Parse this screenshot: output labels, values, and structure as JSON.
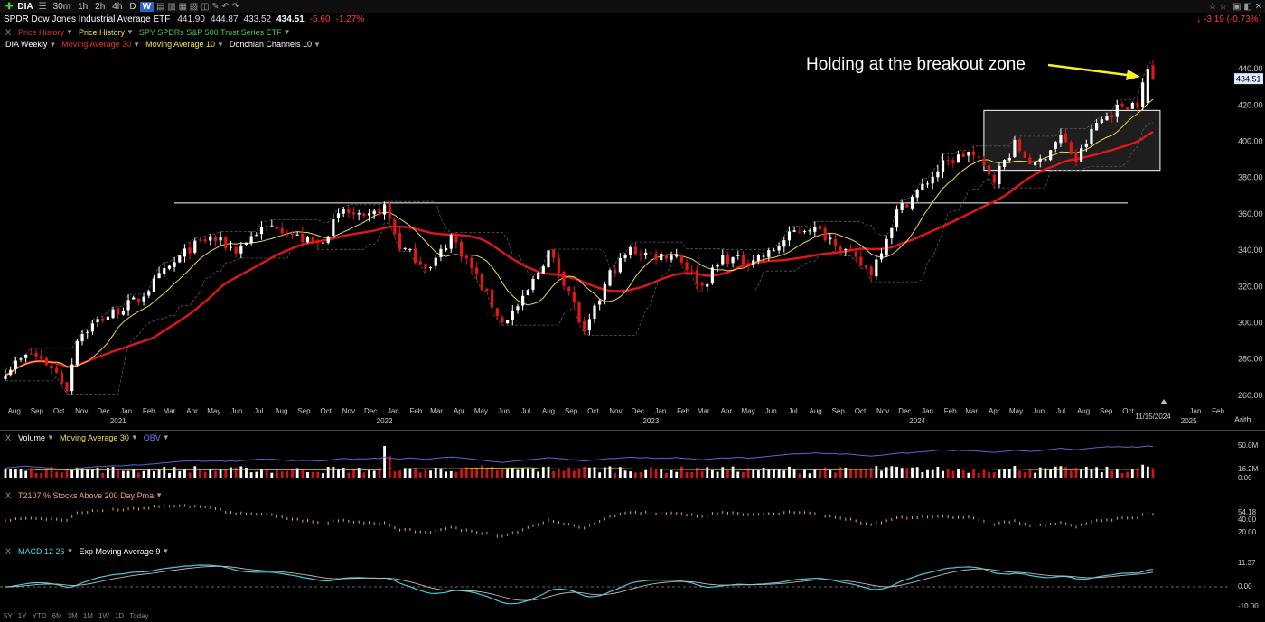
{
  "toolbar": {
    "symbol": "DIA",
    "intervals": [
      "30m",
      "1h",
      "2h",
      "4h",
      "D",
      "W"
    ],
    "active_interval": "W"
  },
  "title": {
    "name": "SPDR Dow Jones Industrial Average ETF",
    "open": "441.90",
    "high": "444.87",
    "low": "433.52",
    "last": "434.51",
    "change": "-5.60",
    "change_pct": "-1.27%",
    "right_change": "-3.19 (-0.73%)"
  },
  "overlays": {
    "price_history_1": "Price History",
    "price_history_2": "Price History",
    "spy": "SPY SPDRs S&P 500 Trust Series ETF"
  },
  "studies": {
    "chart_label": "DIA Weekly",
    "ma30": "Moving Average 30",
    "ma10": "Moving Average 10",
    "donchian": "Donchian Channels 10"
  },
  "annotation": {
    "text": "Holding at the breakout zone"
  },
  "price_axis": {
    "labels": [
      "440.00",
      "420.00",
      "400.00",
      "380.00",
      "360.00",
      "340.00",
      "320.00",
      "300.00",
      "280.00",
      "260.00"
    ],
    "last_price": "434.51"
  },
  "date_axis": {
    "months": [
      "Aug",
      "Sep",
      "Oct",
      "Nov",
      "Dec",
      "Jan",
      "Feb",
      "Mar",
      "Apr",
      "May",
      "Jun",
      "Jul",
      "Aug",
      "Sep",
      "Oct",
      "Nov",
      "Dec",
      "Jan",
      "Feb",
      "Mar",
      "Apr",
      "May",
      "Jun",
      "Jul",
      "Aug",
      "Sep",
      "Oct",
      "Nov",
      "Dec",
      "Jan",
      "Feb",
      "Mar",
      "Apr",
      "May",
      "Jun",
      "Jul",
      "Aug",
      "Sep",
      "Oct",
      "Nov",
      "Dec",
      "Jan",
      "Feb",
      "Mar",
      "Apr",
      "May",
      "Jun",
      "Jul",
      "Aug",
      "Sep",
      "Oct",
      "Jan",
      "Feb"
    ],
    "years": [
      "2021",
      "2022",
      "2023",
      "2024",
      "2025"
    ],
    "cursor_date": "11/15/2024",
    "scale_mode": "Arith"
  },
  "volume_pane": {
    "label": "Volume",
    "ma": "Moving Average 30",
    "obv": "OBV",
    "axis_labels": [
      "50.0M",
      "16.2M",
      "0.00"
    ]
  },
  "breadth_pane": {
    "label": "T2107 % Stocks Above 200 Day Pma",
    "axis_labels": [
      "54.18",
      "40.00",
      "20.00"
    ]
  },
  "macd_pane": {
    "label": "MACD 12 26",
    "signal": "Exp Moving Average 9",
    "axis_labels": [
      "11.37",
      "0.00",
      "-10.00"
    ]
  },
  "footer": {
    "ranges": [
      "5Y",
      "1Y",
      "YTD",
      "6M",
      "3M",
      "1M",
      "1W",
      "1D",
      "Today"
    ]
  },
  "colors": {
    "up": "#ffffff",
    "down": "#e01818",
    "ma30": "#e0161c",
    "ma10": "#e8d84a",
    "obv": "#5a63d8",
    "macd": "#4ec8d8",
    "signal": "#bbbbbb",
    "annotation": "#f5f02a"
  },
  "chart_data": {
    "type": "candlestick",
    "title": "SPDR Dow Jones Industrial Average ETF",
    "ylim": [
      255,
      450
    ],
    "grid": false,
    "start_date": "2020-08-03",
    "resistance_level": 366,
    "breakout_zone": {
      "from": "2024-04-01",
      "to": "2024-12-23",
      "low": 384,
      "high": 417
    },
    "close_anchors": [
      [
        "2020-08-03",
        274
      ],
      [
        "2020-09-07",
        283
      ],
      [
        "2020-10-05",
        276
      ],
      [
        "2020-10-26",
        264
      ],
      [
        "2020-11-09",
        292
      ],
      [
        "2020-12-07",
        301
      ],
      [
        "2021-01-04",
        307
      ],
      [
        "2021-02-01",
        313
      ],
      [
        "2021-03-01",
        325
      ],
      [
        "2021-04-12",
        341
      ],
      [
        "2021-05-10",
        347
      ],
      [
        "2021-06-14",
        340
      ],
      [
        "2021-07-12",
        350
      ],
      [
        "2021-08-09",
        354
      ],
      [
        "2021-09-06",
        347
      ],
      [
        "2021-10-04",
        343
      ],
      [
        "2021-11-08",
        362
      ],
      [
        "2021-12-06",
        356
      ],
      [
        "2022-01-03",
        364
      ],
      [
        "2022-01-24",
        342
      ],
      [
        "2022-03-07",
        330
      ],
      [
        "2022-04-04",
        348
      ],
      [
        "2022-05-02",
        330
      ],
      [
        "2022-06-13",
        300
      ],
      [
        "2022-07-11",
        312
      ],
      [
        "2022-08-15",
        339
      ],
      [
        "2022-09-12",
        318
      ],
      [
        "2022-10-03",
        293
      ],
      [
        "2022-11-07",
        327
      ],
      [
        "2022-12-05",
        340
      ],
      [
        "2023-01-09",
        337
      ],
      [
        "2023-02-06",
        338
      ],
      [
        "2023-03-13",
        320
      ],
      [
        "2023-04-10",
        336
      ],
      [
        "2023-05-08",
        334
      ],
      [
        "2023-06-12",
        338
      ],
      [
        "2023-07-17",
        350
      ],
      [
        "2023-08-07",
        353
      ],
      [
        "2023-09-11",
        345
      ],
      [
        "2023-10-09",
        334
      ],
      [
        "2023-10-30",
        328
      ],
      [
        "2023-12-04",
        361
      ],
      [
        "2024-01-08",
        375
      ],
      [
        "2024-02-05",
        387
      ],
      [
        "2024-03-11",
        394
      ],
      [
        "2024-04-15",
        380
      ],
      [
        "2024-05-13",
        398
      ],
      [
        "2024-06-10",
        386
      ],
      [
        "2024-07-15",
        403
      ],
      [
        "2024-08-05",
        389
      ],
      [
        "2024-09-02",
        410
      ],
      [
        "2024-10-07",
        420
      ],
      [
        "2024-10-28",
        421
      ],
      [
        "2024-11-11",
        440
      ],
      [
        "2024-11-18",
        434.51
      ]
    ]
  }
}
